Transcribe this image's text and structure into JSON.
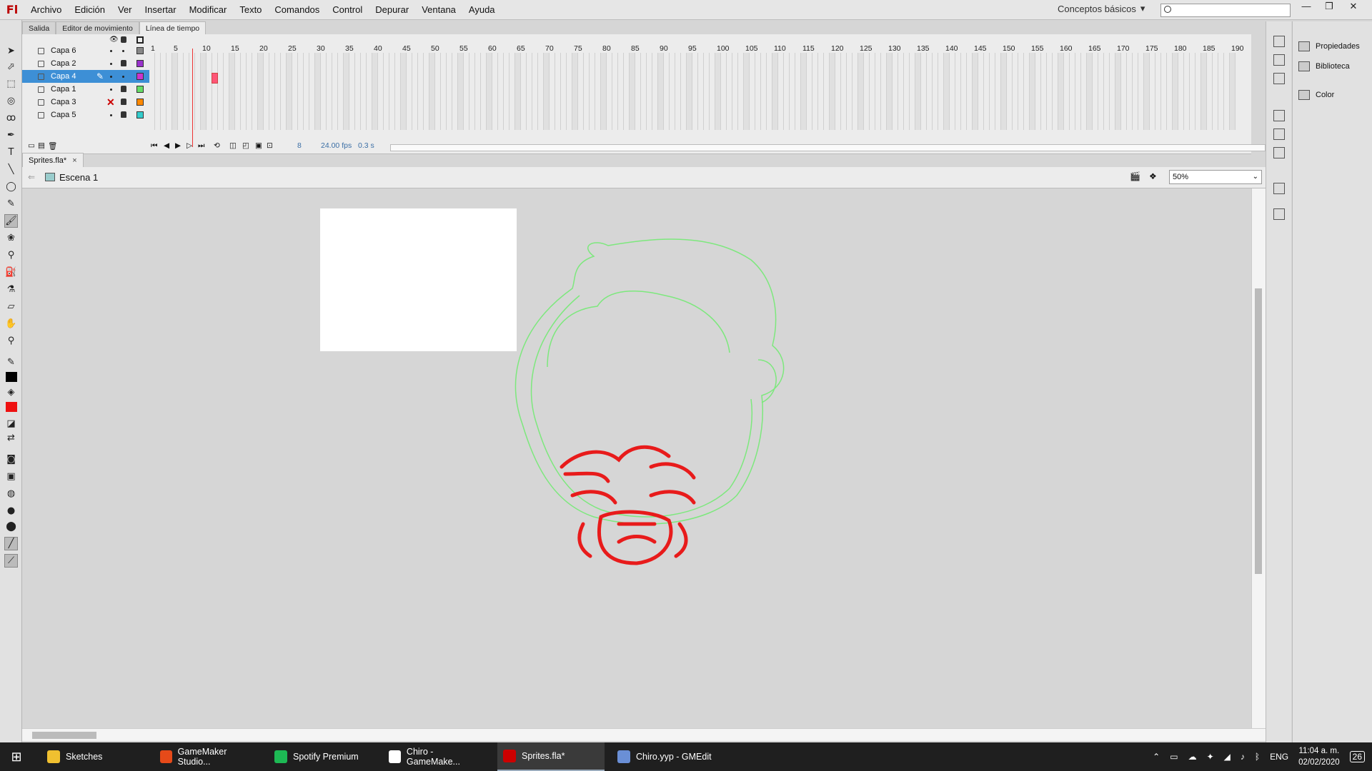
{
  "app": {
    "logo": "Fl",
    "menu": [
      "Archivo",
      "Edición",
      "Ver",
      "Insertar",
      "Modificar",
      "Texto",
      "Comandos",
      "Control",
      "Depurar",
      "Ventana",
      "Ayuda"
    ],
    "workspace_label": "Conceptos básicos",
    "window_buttons": [
      "—",
      "❐",
      "✕"
    ]
  },
  "panel_tabs": [
    "Salida",
    "Editor de movimiento",
    "Línea de tiempo"
  ],
  "timeline": {
    "layers": [
      {
        "name": "Capa 6",
        "color": "#888888",
        "locked": false,
        "hidden": false,
        "selected": false
      },
      {
        "name": "Capa 2",
        "color": "#9933cc",
        "locked": true,
        "hidden": false,
        "selected": false
      },
      {
        "name": "Capa 4",
        "color": "#cc33cc",
        "locked": false,
        "hidden": false,
        "selected": true
      },
      {
        "name": "Capa 1",
        "color": "#66dd66",
        "locked": true,
        "hidden": false,
        "selected": false
      },
      {
        "name": "Capa 3",
        "color": "#ff8800",
        "locked": true,
        "hidden": true,
        "selected": false
      },
      {
        "name": "Capa 5",
        "color": "#33cccc",
        "locked": true,
        "hidden": false,
        "selected": false
      }
    ],
    "frame_numbers": [
      "1",
      "5",
      "10",
      "15",
      "20",
      "25",
      "30",
      "35",
      "40",
      "45",
      "50",
      "55",
      "60",
      "65",
      "70",
      "75",
      "80",
      "85",
      "90",
      "95",
      "100",
      "105",
      "110",
      "115",
      "120",
      "125",
      "130",
      "135",
      "140",
      "145",
      "150",
      "155",
      "160",
      "165",
      "170",
      "175",
      "180",
      "185",
      "190"
    ],
    "current_frame": "8",
    "fps": "24.00 fps",
    "time": "0.3 s"
  },
  "document": {
    "tab_label": "Sprites.fla*",
    "close_glyph": "×",
    "scene": "Escena 1",
    "zoom": "50%"
  },
  "right_panel": [
    "Propiedades",
    "Biblioteca",
    "Color"
  ],
  "taskbar": {
    "tasks": [
      {
        "label": "Sketches",
        "color": "#f0c030",
        "active": false
      },
      {
        "label": "GameMaker Studio...",
        "color": "#e64a19",
        "active": false
      },
      {
        "label": "Spotify Premium",
        "color": "#1db954",
        "active": false
      },
      {
        "label": "Chiro - GameMake...",
        "color": "#ffffff",
        "active": false
      },
      {
        "label": "Sprites.fla*",
        "color": "#cc0000",
        "active": true
      },
      {
        "label": "Chiro.yyp - GMEdit",
        "color": "#6a8fd6",
        "active": false
      }
    ],
    "language": "ENG",
    "time": "11:04 a. m.",
    "date": "02/02/2020",
    "notifications": "26"
  }
}
